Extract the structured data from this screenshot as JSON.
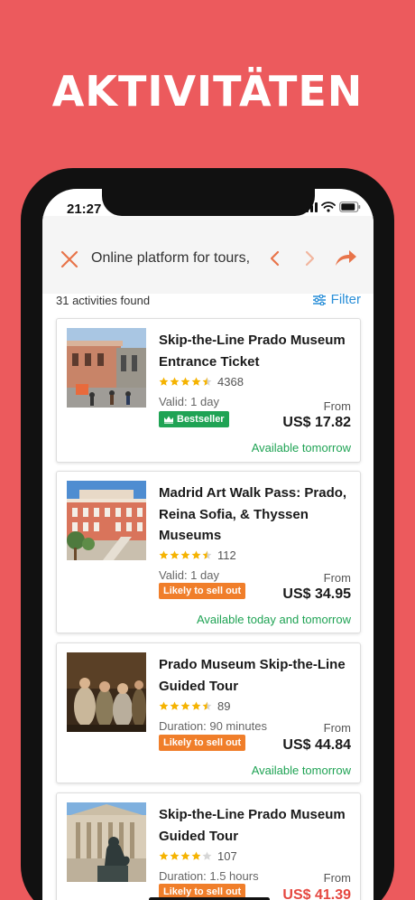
{
  "headline": "AKTIVITÄTEN",
  "status": {
    "time": "21:27"
  },
  "search": {
    "query": "Online platform for tours,"
  },
  "results": {
    "count_text": "31 activities found",
    "filter_label": "Filter"
  },
  "colors": {
    "accent": "#EC5A5D",
    "filter_blue": "#2A8FD8",
    "green": "#1FA354",
    "orange": "#F07E2A",
    "price_red": "#E5463F"
  },
  "activities": [
    {
      "title": "Skip-the-Line Prado Museum Entrance Ticket",
      "rating": 4.5,
      "rating_count": "4368",
      "meta": "Valid: 1 day",
      "badge": "Bestseller",
      "from": "From",
      "price": "US$ 17.82",
      "availability": "Available tomorrow"
    },
    {
      "title": "Madrid Art Walk Pass: Prado, Reina Sofia, & Thyssen Museums",
      "rating": 4.5,
      "rating_count": "112",
      "meta": "Valid: 1 day",
      "badge": "Likely to sell out",
      "from": "From",
      "price": "US$ 34.95",
      "availability": "Available today and tomorrow"
    },
    {
      "title": "Prado Museum Skip-the-Line Guided Tour",
      "rating": 4.5,
      "rating_count": "89",
      "meta": "Duration: 90 minutes",
      "badge": "Likely to sell out",
      "from": "From",
      "price": "US$ 44.84",
      "availability": "Available tomorrow"
    },
    {
      "title": "Skip-the-Line Prado Museum Guided Tour",
      "rating": 4,
      "rating_count": "107",
      "meta": "Duration: 1.5 hours",
      "badge": "Likely to sell out",
      "from": "From",
      "price": "US$ 41.39",
      "availability": ""
    }
  ]
}
